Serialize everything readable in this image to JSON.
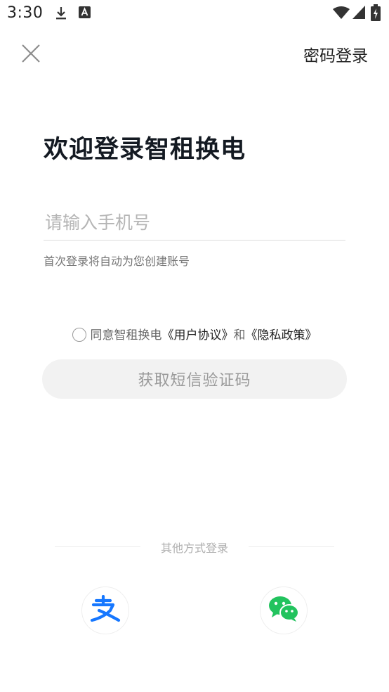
{
  "status_bar": {
    "time": "3:30",
    "icons": [
      "download-icon",
      "font-icon",
      "wifi-icon",
      "signal-icon",
      "battery-charging-icon"
    ]
  },
  "header": {
    "close_icon": "close-icon",
    "password_login_label": "密码登录"
  },
  "title": "欢迎登录智租换电",
  "phone_input": {
    "placeholder": "请输入手机号",
    "value": ""
  },
  "hint": "首次登录将自动为您创建账号",
  "agreement": {
    "prefix": "同意智租换电",
    "user_agreement": "《用户协议》",
    "conjunction": "和",
    "privacy_policy": "《隐私政策》",
    "checked": false
  },
  "get_code_button": "获取短信验证码",
  "other_login": {
    "label": "其他方式登录",
    "methods": [
      "alipay-icon",
      "wechat-icon"
    ]
  },
  "colors": {
    "alipay_blue": "#1677ff",
    "wechat_green": "#22c35e",
    "button_bg": "#f2f2f2",
    "title_text": "#141a22"
  }
}
